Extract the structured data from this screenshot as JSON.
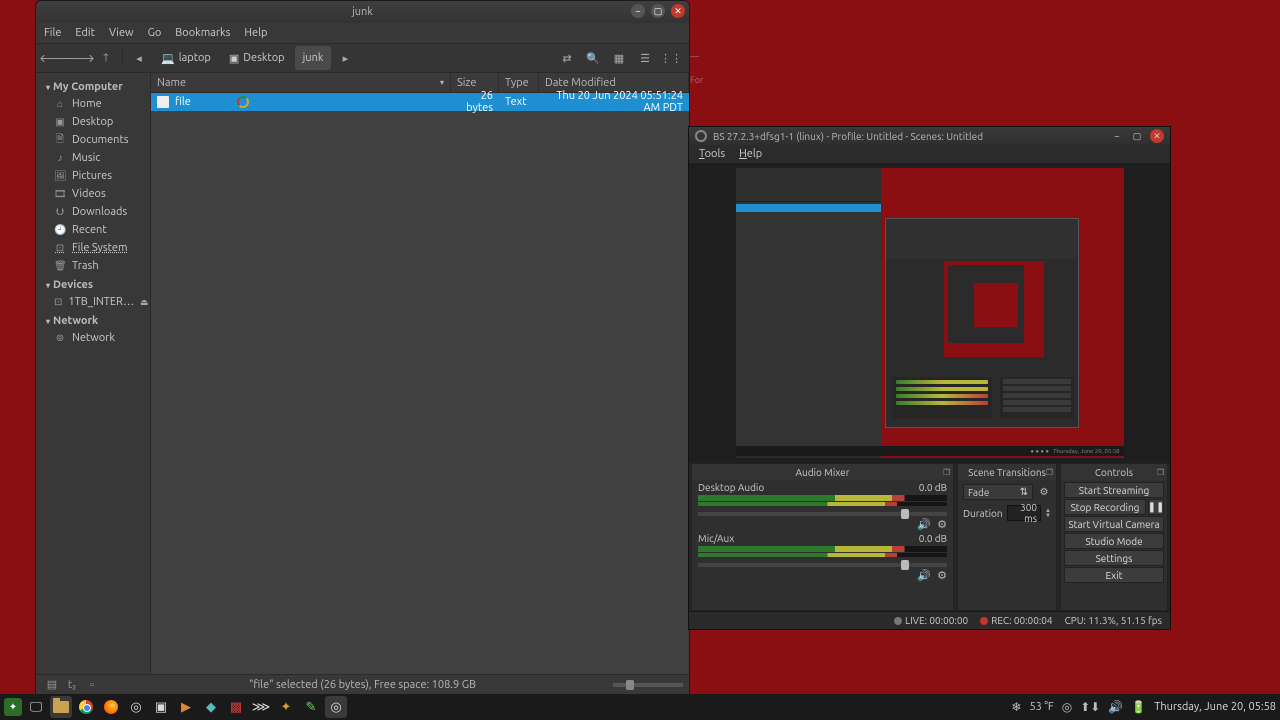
{
  "fm": {
    "title": "junk",
    "menu": [
      "File",
      "Edit",
      "View",
      "Go",
      "Bookmarks",
      "Help"
    ],
    "breadcrumbs": [
      {
        "icon": "laptop",
        "label": "laptop"
      },
      {
        "icon": "folder",
        "label": "Desktop"
      },
      {
        "icon": "",
        "label": "junk",
        "active": true
      }
    ],
    "sidebar": {
      "my_computer": "My Computer",
      "items": [
        {
          "icon": "🏠",
          "label": "Home"
        },
        {
          "icon": "▣",
          "label": "Desktop"
        },
        {
          "icon": "🗎",
          "label": "Documents"
        },
        {
          "icon": "♪",
          "label": "Music"
        },
        {
          "icon": "🖼",
          "label": "Pictures"
        },
        {
          "icon": "🎞",
          "label": "Videos"
        },
        {
          "icon": "⮋",
          "label": "Downloads"
        },
        {
          "icon": "🕘",
          "label": "Recent"
        },
        {
          "icon": "⊡",
          "label": "File System",
          "underline": true
        },
        {
          "icon": "🗑",
          "label": "Trash"
        }
      ],
      "devices": "Devices",
      "device_items": [
        {
          "icon": "⊡",
          "label": "1TB_INTER…",
          "eject": true
        }
      ],
      "network": "Network",
      "network_items": [
        {
          "icon": "⊚",
          "label": "Network"
        }
      ]
    },
    "columns": {
      "name": "Name",
      "size": "Size",
      "type": "Type",
      "date": "Date Modified"
    },
    "rows": [
      {
        "name": "file",
        "size": "26 bytes",
        "type": "Text",
        "date": "Thu 20 Jun 2024 05:51:24 AM PDT",
        "selected": true
      }
    ],
    "status": "\"file\" selected (26 bytes), Free space: 108.9 GB"
  },
  "obs": {
    "title": "BS 27.2.3+dfsg1-1 (linux) - Profile: Untitled - Scenes: Untitled",
    "menu": [
      "Tools",
      "Help"
    ],
    "mixer": {
      "title": "Audio Mixer",
      "channels": [
        {
          "name": "Desktop Audio",
          "db": "0.0 dB"
        },
        {
          "name": "Mic/Aux",
          "db": "0.0 dB"
        }
      ]
    },
    "transitions": {
      "title": "Scene Transitions",
      "selected": "Fade",
      "duration_label": "Duration",
      "duration_value": "300 ms"
    },
    "controls": {
      "title": "Controls",
      "buttons": [
        "Start Streaming",
        "Stop Recording",
        "Start Virtual Camera",
        "Studio Mode",
        "Settings",
        "Exit"
      ]
    },
    "status": {
      "live": "LIVE: 00:00:00",
      "rec": "REC: 00:00:04",
      "cpu": "CPU: 11.3%, 51.15 fps"
    }
  },
  "taskbar": {
    "weather": "53 °F",
    "clock": "Thursday, June 20, 05:58"
  }
}
